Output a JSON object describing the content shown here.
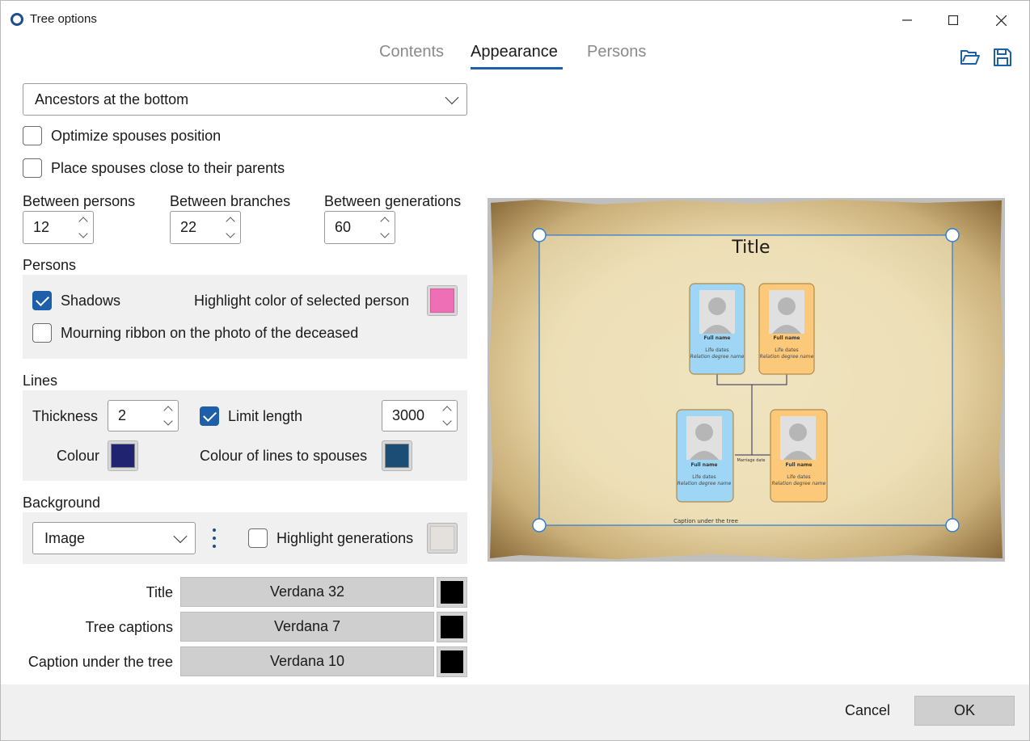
{
  "window": {
    "title": "Tree options"
  },
  "tabs": [
    {
      "label": "Contents"
    },
    {
      "label": "Appearance"
    },
    {
      "label": "Persons"
    }
  ],
  "layout_dropdown": {
    "value": "Ancestors at the bottom"
  },
  "options": {
    "optimize_spouses": {
      "label": "Optimize spouses position",
      "checked": false
    },
    "place_spouses": {
      "label": "Place spouses close to their parents",
      "checked": false
    }
  },
  "spacing": {
    "between_persons": {
      "label": "Between persons",
      "value": "12"
    },
    "between_branches": {
      "label": "Between branches",
      "value": "22"
    },
    "between_generations": {
      "label": "Between generations",
      "value": "60"
    }
  },
  "persons": {
    "section_label": "Persons",
    "shadows": {
      "label": "Shadows",
      "checked": true
    },
    "highlight_color_label": "Highlight color of selected person",
    "highlight_color": "#ee6fb6",
    "mourning": {
      "label": "Mourning ribbon on the photo of the deceased",
      "checked": false
    }
  },
  "lines": {
    "section_label": "Lines",
    "thickness_label": "Thickness",
    "thickness_value": "2",
    "limit_length": {
      "label": "Limit length",
      "checked": true
    },
    "length_value": "3000",
    "colour_label": "Colour",
    "colour": "#1f2370",
    "spouse_colour_label": "Colour of lines to spouses",
    "spouse_colour": "#1c4d75"
  },
  "background": {
    "section_label": "Background",
    "type_value": "Image",
    "highlight_generations": {
      "label": "Highlight generations",
      "checked": false
    },
    "highlight_swatch": "#e4e0dc"
  },
  "fonts": [
    {
      "label": "Title",
      "value": "Verdana 32",
      "color": "#000000"
    },
    {
      "label": "Tree captions",
      "value": "Verdana 7",
      "color": "#000000"
    },
    {
      "label": "Caption under the tree",
      "value": "Verdana 10",
      "color": "#000000"
    }
  ],
  "preview": {
    "title": "Title",
    "card_name": "Full name",
    "card_dates": "Life dates",
    "card_relation": "Relation degree name",
    "marriage_date": "Marriage date",
    "caption_under": "Caption under the tree"
  },
  "footer": {
    "cancel_label": "Cancel",
    "ok_label": "OK"
  }
}
